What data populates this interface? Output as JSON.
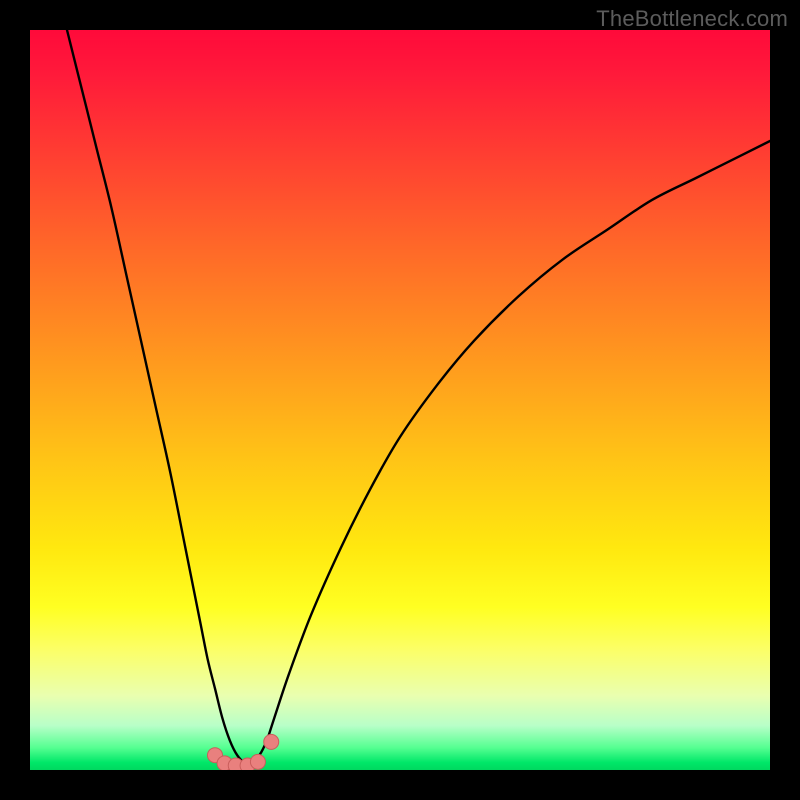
{
  "watermark": "TheBottleneck.com",
  "colors": {
    "frame_bg_top": "#ff0a3a",
    "frame_bg_bottom": "#00d85f",
    "page_bg": "#000000",
    "curve_stroke": "#000000",
    "marker_fill": "#e9807e",
    "marker_stroke": "#c95d5b"
  },
  "chart_data": {
    "type": "line",
    "title": "",
    "xlabel": "",
    "ylabel": "",
    "xlim": [
      0,
      100
    ],
    "ylim": [
      0,
      100
    ],
    "grid": false,
    "legend": false,
    "series": [
      {
        "name": "bottleneck-curve",
        "x": [
          5,
          7,
          9,
          11,
          13,
          15,
          17,
          19,
          21,
          23,
          24,
          25,
          26,
          27,
          28,
          29,
          30,
          31,
          32,
          33,
          35,
          38,
          42,
          46,
          50,
          55,
          60,
          66,
          72,
          78,
          84,
          90,
          96,
          100
        ],
        "y": [
          100,
          92,
          84,
          76,
          67,
          58,
          49,
          40,
          30,
          20,
          15,
          11,
          7,
          4,
          2,
          1,
          1,
          2,
          4,
          7,
          13,
          21,
          30,
          38,
          45,
          52,
          58,
          64,
          69,
          73,
          77,
          80,
          83,
          85
        ]
      }
    ],
    "markers": [
      {
        "x": 25.0,
        "y": 2.0
      },
      {
        "x": 26.3,
        "y": 0.9
      },
      {
        "x": 27.8,
        "y": 0.6
      },
      {
        "x": 29.4,
        "y": 0.6
      },
      {
        "x": 30.8,
        "y": 1.1
      },
      {
        "x": 32.6,
        "y": 3.8
      }
    ]
  }
}
